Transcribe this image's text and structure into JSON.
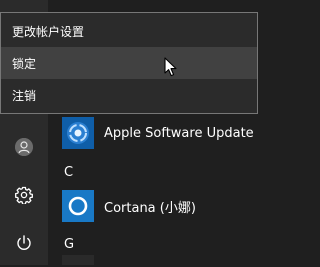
{
  "context_menu": {
    "items": [
      {
        "label": "更改帐户设置",
        "hovered": false
      },
      {
        "label": "锁定",
        "hovered": true
      },
      {
        "label": "注销",
        "hovered": false
      }
    ]
  },
  "rail": {
    "items": [
      {
        "name": "account",
        "icon": "user-avatar-icon"
      },
      {
        "name": "settings",
        "icon": "gear-icon"
      },
      {
        "name": "power",
        "icon": "power-icon"
      }
    ]
  },
  "app_list": {
    "apps": [
      {
        "label": "Apple Software Update",
        "icon": "apple-software-update-icon",
        "tile_color": "#0f5ea8"
      },
      {
        "label": "Cortana (小娜)",
        "icon": "cortana-ring-icon",
        "tile_color": "#1979c6"
      }
    ],
    "section_letters": [
      "C",
      "G"
    ]
  },
  "colors": {
    "background": "#1f1f1f",
    "rail": "#2b2b2b",
    "menu_hover": "#414141",
    "menu_border": "#777777"
  }
}
